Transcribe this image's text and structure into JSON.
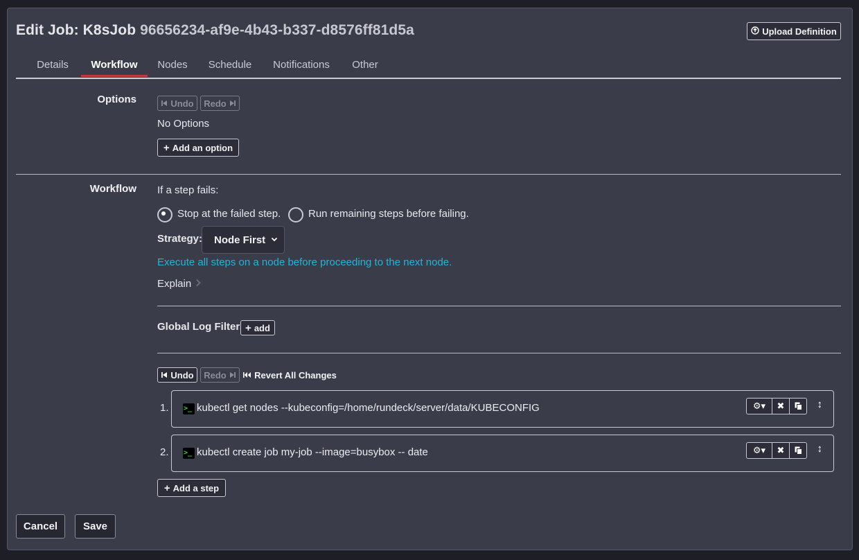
{
  "header": {
    "title_prefix": "Edit Job: K8sJob",
    "job_id": "96656234-af9e-4b43-b337-d8576ff81d5a",
    "upload_label": "Upload Definition",
    "upload_icon": "upload-circle-icon"
  },
  "tabs": [
    {
      "label": "Details"
    },
    {
      "label": "Workflow",
      "active": true
    },
    {
      "label": "Nodes"
    },
    {
      "label": "Schedule"
    },
    {
      "label": "Notifications"
    },
    {
      "label": "Other"
    }
  ],
  "options": {
    "section_label": "Options",
    "undo_label": "Undo",
    "redo_label": "Redo",
    "empty_text": "No Options",
    "add_label": "Add an option"
  },
  "workflow": {
    "section_label": "Workflow",
    "fail_prompt": "If a step fails:",
    "radio_stop": "Stop at the failed step.",
    "radio_run": "Run remaining steps before failing.",
    "strategy_label": "Strategy:",
    "strategy_value": "Node First",
    "strategy_info": "Execute all steps on a node before proceeding to the next node.",
    "explain_label": "Explain",
    "log_filters_label": "Global Log Filters",
    "add_filter_label": "add",
    "undo_label": "Undo",
    "redo_label": "Redo",
    "revert_label": "Revert All Changes",
    "steps": [
      {
        "num": "1.",
        "command": "kubectl get nodes --kubeconfig=/home/rundeck/server/data/KUBECONFIG"
      },
      {
        "num": "2.",
        "command": "kubectl create job my-job --image=busybox -- date"
      }
    ],
    "add_step_label": "Add a step"
  },
  "footer": {
    "cancel_label": "Cancel",
    "save_label": "Save"
  },
  "colors": {
    "background": "#3b3c4a",
    "active_tab_underline": "#c4383c",
    "info_text": "#1eb7d9"
  }
}
